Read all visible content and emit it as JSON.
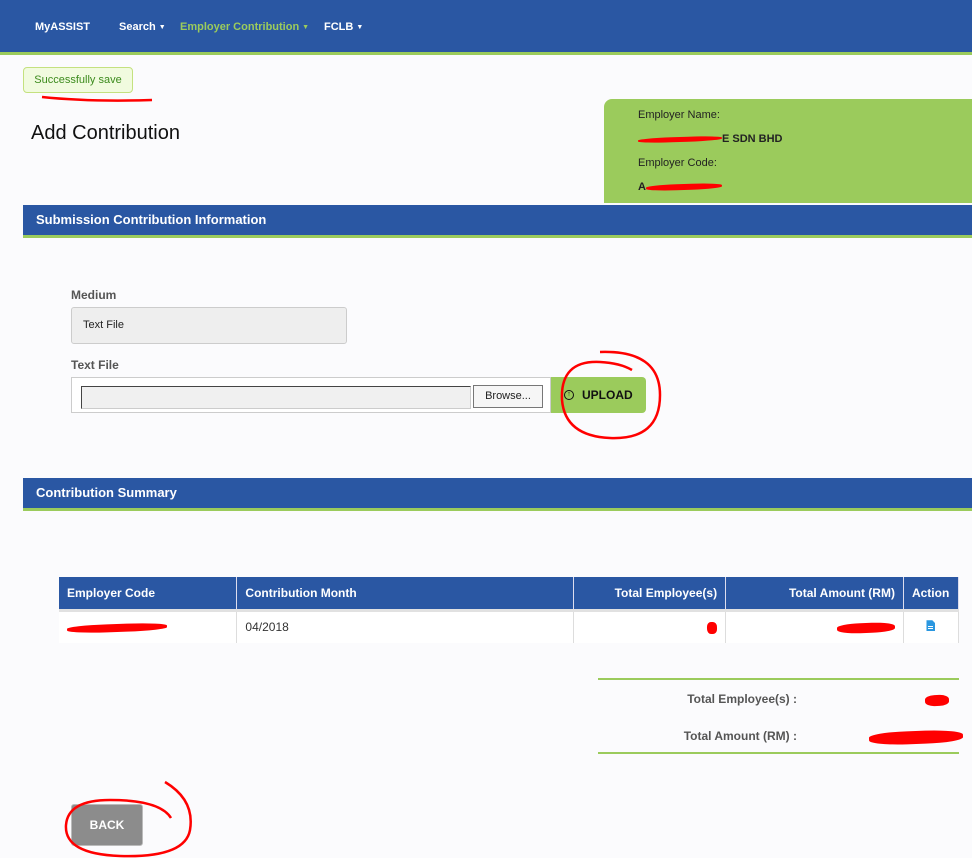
{
  "navbar": {
    "brand": "MyASSIST",
    "items": [
      {
        "label": "Search",
        "caret": "▼",
        "active": false
      },
      {
        "label": "Employer Contribution",
        "caret": "▼",
        "active": true
      },
      {
        "label": "FCLB",
        "caret": "▼",
        "active": false
      }
    ]
  },
  "alert": {
    "message": "Successfully save"
  },
  "page": {
    "title": "Add Contribution"
  },
  "employer": {
    "name_label": "Employer Name:",
    "name_value_visible": "E SDN BHD",
    "code_label": "Employer Code:",
    "code_value_visible": "A",
    "redacted": true
  },
  "submission": {
    "section_title": "Submission Contribution Information",
    "medium_label": "Medium",
    "medium_value": "Text File",
    "file_label": "Text File",
    "file_value": "",
    "browse_label": "Browse...",
    "upload_label": "UPLOAD",
    "upload_icon": "circle-arrow-up-icon"
  },
  "summary": {
    "section_title": "Contribution Summary",
    "columns": [
      "Employer Code",
      "Contribution Month",
      "Total Employee(s)",
      "Total Amount (RM)",
      "Action"
    ],
    "rows": [
      {
        "employer_code": "[redacted]",
        "contribution_month": "04/2018",
        "total_employees": "[redacted]",
        "total_amount": "[redacted]",
        "action_icon": "document-icon"
      }
    ],
    "totals": {
      "employees_label": "Total Employee(s) :",
      "employees_value": "[redacted]",
      "amount_label": "Total Amount (RM) :",
      "amount_value": "[redacted]"
    }
  },
  "footer": {
    "back_label": "BACK"
  },
  "colors": {
    "primary_blue": "#2a57a3",
    "accent_green": "#9bcb5c",
    "alert_text": "#3c8b1d",
    "back_gray": "#8c8c8c",
    "annotation_red": "#ff0000"
  }
}
